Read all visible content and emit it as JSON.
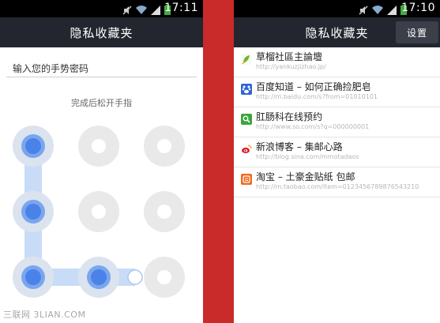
{
  "left_screen": {
    "status": {
      "time": "17:11"
    },
    "title": "隐私收藏夹",
    "password_input_placeholder": "输入您的手势密码",
    "hint": "完成后松开手指"
  },
  "right_screen": {
    "status": {
      "time": "17:10"
    },
    "title": "隐私收藏夹",
    "settings_label": "设置",
    "bookmarks": [
      {
        "title": "草榴社區主論壇",
        "url": "http://yankuzjizhao.jp/",
        "icon": "leaf-icon",
        "icon_color": "#f7fbf0"
      },
      {
        "title": "百度知道 – 如何正确捡肥皂",
        "url": "http://m.baidu.com/s?from=01010101",
        "icon": "baidu-icon",
        "icon_color": "#2f64d8"
      },
      {
        "title": "肛肠科在线预约",
        "url": "http://www.so.com/s?q=000000001",
        "icon": "search-icon",
        "icon_color": "#3aa63a"
      },
      {
        "title": "新浪博客 – 集邮心路",
        "url": "http://blog.sina.com/mmotadaos",
        "icon": "weibo-icon",
        "icon_color": "#ffffff"
      },
      {
        "title": "淘宝 – 土豪金贴纸 包邮",
        "url": "http://m.taobao.com/item=0123456789876543210",
        "icon": "taobao-icon",
        "icon_color": "#f26b1d"
      }
    ]
  },
  "watermark": "三联网 3LIAN.COM"
}
